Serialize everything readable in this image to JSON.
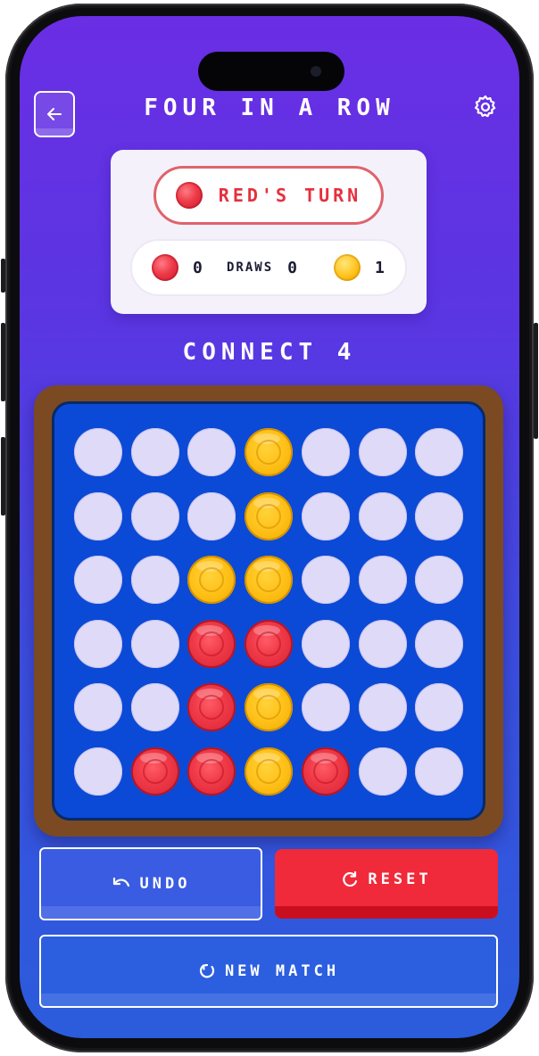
{
  "header": {
    "title": "FOUR IN A ROW",
    "back_icon": "arrow-left-icon",
    "settings_icon": "gear-icon"
  },
  "status": {
    "turn_label": "RED'S TURN",
    "turn_color": "red"
  },
  "scores": {
    "red": "0",
    "draws_label": "DRAWS",
    "draws": "0",
    "yellow": "1"
  },
  "subtitle": "CONNECT 4",
  "board": {
    "rows": 6,
    "cols": 7,
    "cells": [
      [
        "empty",
        "empty",
        "empty",
        "yellow",
        "empty",
        "empty",
        "empty"
      ],
      [
        "empty",
        "empty",
        "empty",
        "yellow",
        "empty",
        "empty",
        "empty"
      ],
      [
        "empty",
        "empty",
        "yellow",
        "yellow",
        "empty",
        "empty",
        "empty"
      ],
      [
        "empty",
        "empty",
        "red",
        "red",
        "empty",
        "empty",
        "empty"
      ],
      [
        "empty",
        "empty",
        "red",
        "yellow",
        "empty",
        "empty",
        "empty"
      ],
      [
        "empty",
        "red",
        "red",
        "yellow",
        "red",
        "empty",
        "empty"
      ]
    ]
  },
  "actions": {
    "undo_label": "UNDO",
    "reset_label": "RESET",
    "new_match_label": "NEW MATCH"
  },
  "colors": {
    "red": "#ee3a48",
    "yellow": "#ffc21a",
    "board": "#0b4ad6",
    "frame": "#7b4a22",
    "empty_slot": "#dedaf8"
  }
}
